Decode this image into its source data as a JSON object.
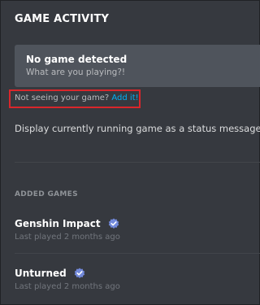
{
  "header": {
    "title": "GAME ACTIVITY"
  },
  "detected_card": {
    "title": "No game detected",
    "subtitle": "What are you playing?!"
  },
  "hint": {
    "prefix": "Not seeing your game?",
    "link": "Add it!"
  },
  "display_option": {
    "label": "Display currently running game as a status message."
  },
  "added_games": {
    "section_label": "ADDED GAMES",
    "items": [
      {
        "name": "Genshin Impact",
        "last_played": "Last played 2 months ago",
        "verified_icon": "verified-badge-icon"
      },
      {
        "name": "Unturned",
        "last_played": "Last played 2 months ago",
        "verified_icon": "verified-badge-icon"
      }
    ]
  },
  "colors": {
    "background": "#36393f",
    "card": "#4f545c",
    "link": "#00b0f4",
    "highlight_box": "#d9262b",
    "verified_badge": "#7289da"
  }
}
